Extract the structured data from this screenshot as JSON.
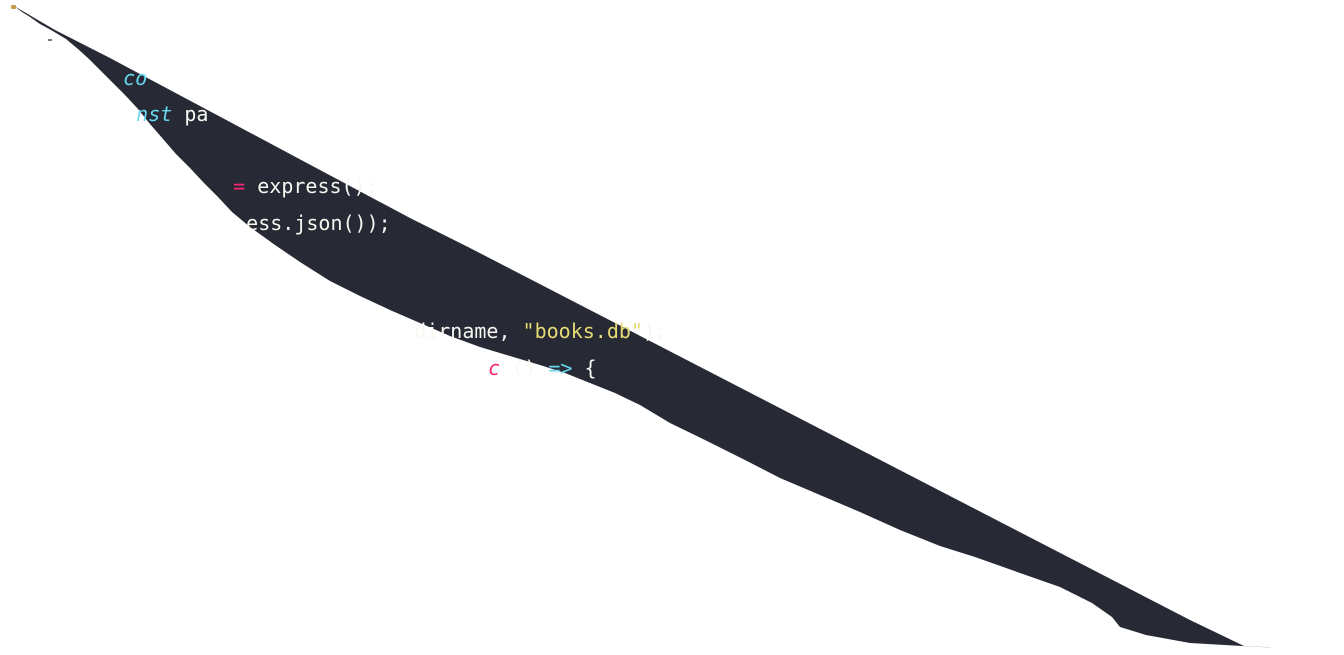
{
  "editor": {
    "theme": {
      "background": "#272934",
      "keyword": "#66d9ef",
      "operator": "#f92672",
      "string": "#e6db74",
      "plain": "#f8f8f2"
    },
    "lines": [
      {
        "keyword": "co"
      },
      {
        "keyword": "nst",
        "plain": " pa"
      },
      {
        "operator": "=",
        "plain": " express();"
      },
      {
        "plain": "ess.json());"
      },
      {
        "plain": "dirname, ",
        "string": "\"books.db\"",
        "plain2": ");"
      },
      {
        "keyword": "c",
        "plain": " () ",
        "arrow": "=>",
        "plain2": " {"
      }
    ]
  }
}
